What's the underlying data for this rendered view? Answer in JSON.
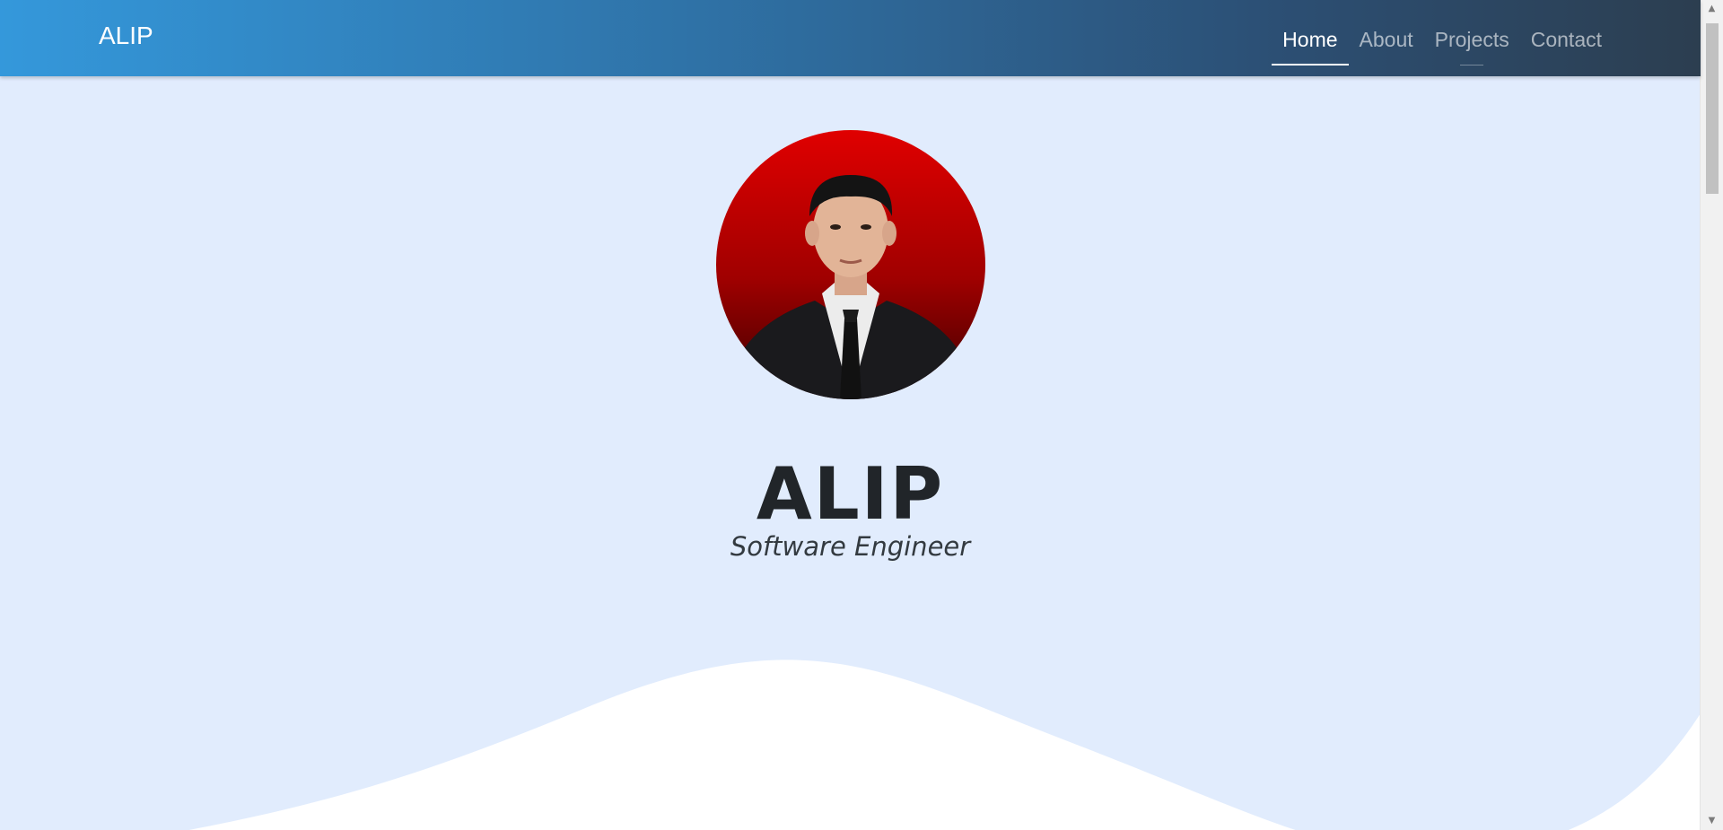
{
  "navbar": {
    "brand": "ALIP",
    "links": [
      {
        "label": "Home",
        "active": true
      },
      {
        "label": "About",
        "active": false
      },
      {
        "label": "Projects",
        "active": false
      },
      {
        "label": "Contact",
        "active": false
      }
    ]
  },
  "hero": {
    "name": "ALIP",
    "title": "Software Engineer",
    "photo_alt": "profile-photo"
  },
  "colors": {
    "nav_gradient_start": "#3498db",
    "nav_gradient_end": "#2c3e50",
    "hero_background": "#e1ecfd",
    "wave": "#ffffff",
    "photo_background": "#d40000"
  },
  "scrollbar": {
    "up_arrow": "▲",
    "down_arrow": "▼"
  }
}
